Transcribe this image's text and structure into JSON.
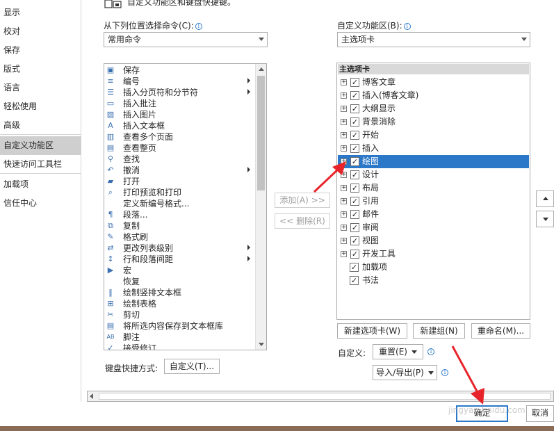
{
  "nav": {
    "items": [
      "显示",
      "校对",
      "保存",
      "版式",
      "语言",
      "轻松使用",
      "高级",
      "自定义功能区",
      "快速访问工具栏",
      "加载项",
      "信任中心"
    ],
    "selected_index": 7
  },
  "top_text": "自定义功能区和键盘快捷键。",
  "left_panel": {
    "label": "从下列位置选择命令(C):",
    "dropdown_value": "常用命令",
    "commands": [
      {
        "label": "保存",
        "icon": "save-icon",
        "submenu": false
      },
      {
        "label": "编号",
        "icon": "numbering-icon",
        "submenu": true
      },
      {
        "label": "插入分页符和分节符",
        "icon": "page-break-icon",
        "submenu": true
      },
      {
        "label": "插入批注",
        "icon": "comment-icon",
        "submenu": false
      },
      {
        "label": "插入图片",
        "icon": "picture-icon",
        "submenu": false
      },
      {
        "label": "插入文本框",
        "icon": "text-box-icon",
        "submenu": false
      },
      {
        "label": "查看多个页面",
        "icon": "multiple-pages-icon",
        "submenu": false
      },
      {
        "label": "查看整页",
        "icon": "one-page-icon",
        "submenu": false
      },
      {
        "label": "查找",
        "icon": "find-icon",
        "submenu": false
      },
      {
        "label": "撤消",
        "icon": "undo-icon",
        "submenu": true
      },
      {
        "label": "打开",
        "icon": "open-folder-icon",
        "submenu": false
      },
      {
        "label": "打印预览和打印",
        "icon": "print-preview-icon",
        "submenu": false
      },
      {
        "label": "定义新编号格式...",
        "icon": "",
        "submenu": false
      },
      {
        "label": "段落...",
        "icon": "paragraph-icon",
        "submenu": false
      },
      {
        "label": "复制",
        "icon": "copy-icon",
        "submenu": false
      },
      {
        "label": "格式刷",
        "icon": "format-painter-icon",
        "submenu": false
      },
      {
        "label": "更改列表级别",
        "icon": "list-level-icon",
        "submenu": true
      },
      {
        "label": "行和段落间距",
        "icon": "line-spacing-icon",
        "submenu": true
      },
      {
        "label": "宏",
        "icon": "macro-icon",
        "submenu": false
      },
      {
        "label": "恢复",
        "icon": "",
        "submenu": false
      },
      {
        "label": "绘制竖排文本框",
        "icon": "vertical-text-box-icon",
        "submenu": false
      },
      {
        "label": "绘制表格",
        "icon": "draw-table-icon",
        "submenu": false
      },
      {
        "label": "剪切",
        "icon": "cut-icon",
        "submenu": false
      },
      {
        "label": "将所选内容保存到文本框库",
        "icon": "save-selection-icon",
        "submenu": false
      },
      {
        "label": "脚注",
        "icon": "footnote-icon",
        "submenu": false
      },
      {
        "label": "接受修订",
        "icon": "accept-changes-icon",
        "submenu": false
      }
    ]
  },
  "middle": {
    "add_label": "添加(A) >>",
    "remove_label": "<< 删除(R)"
  },
  "right_panel": {
    "label": "自定义功能区(B):",
    "dropdown_value": "主选项卡",
    "tree_header": "主选项卡",
    "tabs": [
      {
        "label": "博客文章",
        "checked": true,
        "expandable": true
      },
      {
        "label": "插入(博客文章)",
        "checked": true,
        "expandable": true
      },
      {
        "label": "大纲显示",
        "checked": true,
        "expandable": true
      },
      {
        "label": "背景消除",
        "checked": true,
        "expandable": true
      },
      {
        "label": "开始",
        "checked": true,
        "expandable": true
      },
      {
        "label": "插入",
        "checked": true,
        "expandable": true
      },
      {
        "label": "绘图",
        "checked": true,
        "expandable": true
      },
      {
        "label": "设计",
        "checked": true,
        "expandable": true
      },
      {
        "label": "布局",
        "checked": true,
        "expandable": true
      },
      {
        "label": "引用",
        "checked": true,
        "expandable": true
      },
      {
        "label": "邮件",
        "checked": true,
        "expandable": true
      },
      {
        "label": "审阅",
        "checked": true,
        "expandable": true
      },
      {
        "label": "视图",
        "checked": true,
        "expandable": true
      },
      {
        "label": "开发工具",
        "checked": true,
        "expandable": true
      },
      {
        "label": "加载项",
        "checked": true,
        "expandable": false
      },
      {
        "label": "书法",
        "checked": true,
        "expandable": false
      }
    ],
    "selected_index": 6,
    "new_tab_label": "新建选项卡(W)",
    "new_group_label": "新建组(N)",
    "rename_label": "重命名(M)...",
    "customize_label": "自定义:",
    "reset_label": "重置(E)",
    "import_export_label": "导入/导出(P)"
  },
  "keyboard": {
    "label": "键盘快捷方式:",
    "button_label": "自定义(T)..."
  },
  "footer": {
    "ok_label": "确定",
    "cancel_label": "取消",
    "watermark": "jingyan.baidu.com"
  },
  "colors": {
    "accent": "#2b78c8",
    "selection": "#2b78c8",
    "nav_selected": "#cfcfcf",
    "annotation_arrow": "#e8242b"
  }
}
